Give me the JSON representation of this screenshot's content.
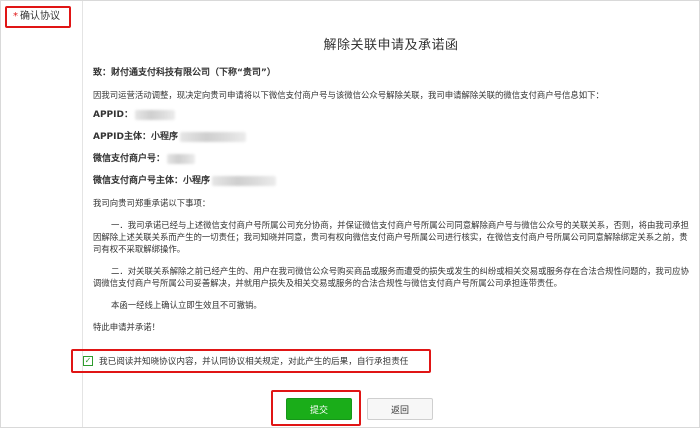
{
  "sidebar": {
    "required_mark": "*",
    "label": "确认协议"
  },
  "document": {
    "title": "解除关联申请及承诺函",
    "addressee": "致：财付通支付科技有限公司（下称“贵司”）",
    "intro": "因我司运营活动调整，现决定向贵司申请将以下微信支付商户号与该微信公众号解除关联，我司申请解除关联的微信支付商户号信息如下：",
    "fields": [
      {
        "label": "APPID："
      },
      {
        "label": "APPID主体：小程序"
      },
      {
        "label": "微信支付商户号："
      },
      {
        "label": "微信支付商户号主体：小程序"
      }
    ],
    "commitment_intro": "我司向贵司郑重承诺以下事项：",
    "clause_1": "一．我司承诺已经与上述微信支付商户号所属公司充分协商，并保证微信支付商户号所属公司同意解除商户号与微信公众号的关联关系，否则，将由我司承担因解除上述关联关系而产生的一切责任；我司知晓并同意，贵司有权向微信支付商户号所属公司进行核实，在微信支付商户号所属公司同意解除绑定关系之前，贵司有权不采取解绑操作。",
    "clause_2": "二．对关联关系解除之前已经产生的、用户在我司微信公众号购买商品或服务而遭受的损失或发生的纠纷或相关交易或服务存在合法合规性问题的，我司应协调微信支付商户号所属公司妥善解决，并就用户损失及相关交易或服务的合法合规性与微信支付商户号所属公司承担连带责任。",
    "effective": "本函一经线上确认立即生效且不可撤销。",
    "closing": "特此申请并承诺！"
  },
  "agreement": {
    "checked": true,
    "check_glyph": "✓",
    "label": "我已阅读并知晓协议内容，并认同协议相关规定，对此产生的后果，自行承担责任"
  },
  "actions": {
    "submit_label": "提交",
    "back_label": "返回"
  },
  "colors": {
    "highlight_red": "#e01515",
    "submit_green": "#1aad19"
  }
}
